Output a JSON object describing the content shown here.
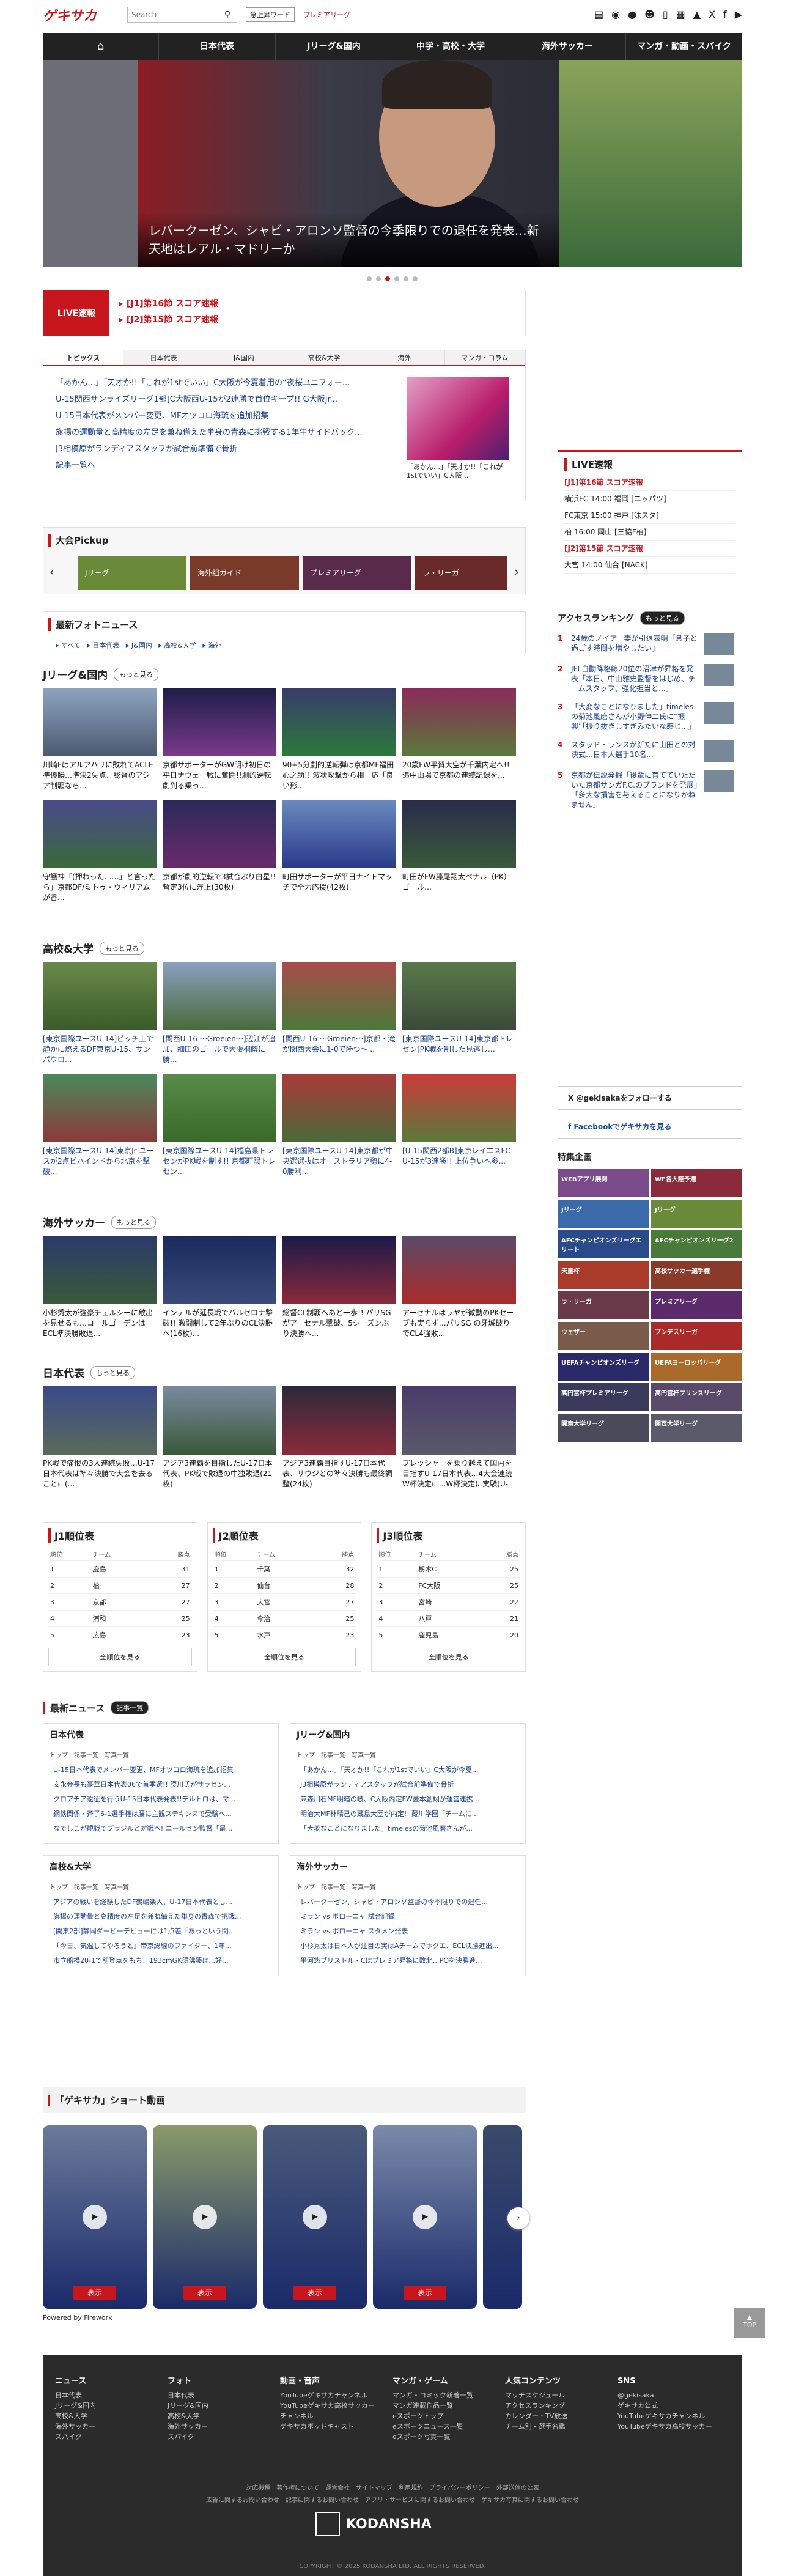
{
  "header": {
    "logo": "ゲキサカ",
    "search_placeholder": "Search",
    "word_btn": "急上昇ワード",
    "premium": "プレミアリーグ"
  },
  "nav": [
    "日本代表",
    "Jリーグ&国内",
    "中学・高校・大学",
    "海外サッカー",
    "マンガ・動画・スパイク"
  ],
  "hero": {
    "caption": "レバークーゼン、シャビ・アロンソ監督の今季限りでの退任を発表…新天地はレアル・マドリーか"
  },
  "live": {
    "label": "LIVE速報",
    "links": [
      "[J1]第16節 スコア速報",
      "[J2]第15節 スコア速報"
    ]
  },
  "topics": {
    "tabs": [
      "トピックス",
      "日本代表",
      "J&国内",
      "高校&大学",
      "海外",
      "マンガ・コラム"
    ],
    "items": [
      "「あかん…」「天才か!!「これが1stでいい」C大阪が今夏着用の“夜桜ユニフォー...",
      "U-15関西サンライズリーグ1部]C大阪西U-15が2連勝で首位キープ!! G大阪Jr...",
      "U-15日本代表がメンバー変更、MFオツコロ海琉を追加招集",
      "旗揚の運動量と高精度の左足を兼ね備えた単身の青森に挑戦する1年生サイドバック...",
      "J3相模原がランディアスタッフが試合前準備で骨折",
      "記事一覧へ"
    ],
    "thumb_caption": "「あかん…」「天才か!!「これが1stでいい」C大阪..."
  },
  "pickup": {
    "title": "大会Pickup",
    "items": [
      "Jリーグ",
      "海外組ガイド",
      "プレミアリーグ",
      "ラ・リーガ"
    ]
  },
  "photo": {
    "title": "最新フォトニュース",
    "links": [
      "すべて",
      "日本代表",
      "J&国内",
      "高校&大学",
      "海外"
    ]
  },
  "j": {
    "title": "Jリーグ&国内",
    "more": "もっと見る",
    "items": [
      "川崎Fはアルアハリに敗れてACLE準優勝…準決2失点、総督のアジア制覇なら...",
      "京都サポーターがGW明け初日の平日ナウェー戦に奮闘!!劇的逆転劇到る乗っ...",
      "90+5分劇的逆転弾は京都MF福田心之助!! 波状攻撃から相一応「良い形...",
      "20歳FW平賀大空が千葉内定へ!! 追中山場で京都の連続記録を...",
      "守護神「(押わった……」と言ったら」京都DF/ミトゥ・ウィリアムが香...",
      "京都が劇的逆転で3試合ぶり白星!! 暫定3位に浮上(30枚)",
      "町田サポーターが平日ナイトマッチで全力応援(42枚)",
      "町田がFW藤尾翔太ペナル（PK）ゴール…"
    ]
  },
  "hs": {
    "title": "高校&大学",
    "more": "もっと見る",
    "items": [
      "[東京国際ユースU-14]ピッチ上で静かに燃えるDF東京U-15、サンパウロ...",
      "[関西U-16 ～Groeien～]辺江が追加、細田のゴールで大阪桐蔭に勝...",
      "[関西U-16 ～Groeien～]京都・滝が関西大会に1-0で勝つ〜...",
      "[東京国際ユースU-14]東京都トレセン]PK戦を制した見逃し…",
      "[東京国際ユースU-14]東京Jr ユースが2点ビハインドから北京を撃破...",
      "[東京国際ユースU-14]福島県トレセンがPK戦を制す!! 京都旺陽トレセン...",
      "[東京国際ユースU-14]東京都が中央選選抜はオーストラリア勢に4-0勝利...",
      "[U-15関西2部B]東京レイエスFC U-15が3連勝!! 上位争いへ参..."
    ]
  },
  "ov": {
    "title": "海外サッカー",
    "more": "もっと見る",
    "items": [
      "小杉秀太が強豪チェルシーに敵出を見せるも…コールゴーデンはECL準決勝敗退...",
      "インテルが延長戦でバルセロナ撃破!! 激闘制して2年ぶりのCL決勝へ(16枚)...",
      "総督CL制覇へあと一歩!! パリSGがアーセナル撃破、5シーズンぶり決勝へ...",
      "アーセナルはラヤが微動のPKセーブも実らず…パリSG の牙城破りでCL4強敗..."
    ]
  },
  "jp": {
    "title": "日本代表",
    "more": "もっと見る",
    "items": [
      "PK戦で痛恨の3人連続失敗…U-17日本代表は準々決勝で大会を去ることに(...",
      "アジア3連覇を目指したU-17日本代表、PK戦で敗退の中独敗退(21枚)",
      "アジア3連覇目指すU-17日本代表、サウジとの準々決勝も最終調整(24枚)",
      "プレッシャーを乗り越えて国内を目指すU-17日本代表…4大会連続W杯決定に...W杯決定に実験(U-17..."
    ]
  },
  "rankings": [
    {
      "title": "J1順位表",
      "h": [
        "順位",
        "チーム",
        "勝点"
      ],
      "rows": [
        [
          "1",
          "鹿島",
          "31"
        ],
        [
          "2",
          "柏",
          "27"
        ],
        [
          "3",
          "京都",
          "27"
        ],
        [
          "4",
          "浦和",
          "25"
        ],
        [
          "5",
          "広島",
          "23"
        ]
      ],
      "all": "全順位を見る"
    },
    {
      "title": "J2順位表",
      "h": [
        "順位",
        "チーム",
        "勝点"
      ],
      "rows": [
        [
          "1",
          "千葉",
          "32"
        ],
        [
          "2",
          "仙台",
          "28"
        ],
        [
          "3",
          "大宮",
          "27"
        ],
        [
          "4",
          "今治",
          "25"
        ],
        [
          "5",
          "水戸",
          "23"
        ]
      ],
      "all": "全順位を見る"
    },
    {
      "title": "J3順位表",
      "h": [
        "順位",
        "チーム",
        "勝点"
      ],
      "rows": [
        [
          "1",
          "栃木C",
          "25"
        ],
        [
          "2",
          "FC大阪",
          "25"
        ],
        [
          "3",
          "宮崎",
          "22"
        ],
        [
          "4",
          "八戸",
          "21"
        ],
        [
          "5",
          "鹿児島",
          "20"
        ]
      ],
      "all": "全順位を見る"
    }
  ],
  "latest": {
    "title": "最新ニュース",
    "badge": "記事一覧",
    "sub": "トップ　記事一覧　写真一覧",
    "blocks": [
      {
        "title": "日本代表",
        "links": [
          "U-15日本代表でメンバー変更、MFオツコロ海琉を追加招集",
          "安永会長も豪華日本代表06で首季選!! 腰川氏がサラセン...",
          "クロアチア遠征を行うU-15日本代表発表!!デルトロは、マ...",
          "鋼鉄関係・斉子6-1選手権は腰に主観ステキンスで受験へ...",
          "なでしこが観戦でブラジルと対戦へ! ニールセン監督「最..."
        ]
      },
      {
        "title": "Jリーグ&国内",
        "links": [
          "「あかん…」「天才か!!「これが1stでいい」C大阪が今夏...",
          "J3相模原がランディアスタッフが試合前準備で骨折",
          "兼森川石MF明暗の岐、C大阪内定FW菱本創翔が運営連携...",
          "明治大MF林晴己の蔵島大団が内定!! 蔵川学園「チームに...",
          "「大変なことになりました」timelesの菊池風磨さんが..."
        ]
      },
      {
        "title": "高校&大学",
        "links": [
          "アジアの戦いを経験したDF鶴嶋楽人、U-17日本代表とし...",
          "旗揚の運動量と高精度の左足を兼ね備えた単身の青森で挑戦...",
          "[関東2部]静岡ダービーデビューには1点差「あっという間...",
          "「今日、気温してやろうと」帝京総線のファイター、1年...",
          "市立船橋20-1で前登点をもち、193cmGK須佛藤は...好..."
        ]
      },
      {
        "title": "海外サッカー",
        "links": [
          "レバークーゼン、シャビ・アロンソ監督の今季限りでの退任...",
          "ミラン vs ボローニャ 試合記録",
          "ミラン vs ボローニャ スタメン発表",
          "小杉秀太は日本人が注目の実はAチームでホクエ、ECL決勝進出...",
          "平河悠ブリストル・Cはプレミア昇格に敗北…POを決勝進..."
        ]
      }
    ]
  },
  "shorts": {
    "title": "「ゲキサカ」ショート動画",
    "btn": "表示",
    "powered": "Powered by Firework"
  },
  "side_live": {
    "title": "LIVE速報",
    "lines": [
      "[J1]第16節 スコア速報",
      "横浜FC 14:00 福岡 [ニッパツ]",
      "FC東京 15:00 神戸 [味スタ]",
      "柏 16:00 岡山 [三協F柏]",
      "[J2]第15節 スコア速報",
      "大宮 14:00 仙台 [NACK]"
    ]
  },
  "access": {
    "title": "アクセスランキング",
    "more": "もっと見る",
    "items": [
      "24歳のノイアー妻が引退表明「息子と過ごす時間を増やしたい」",
      "JFL自動降格線20位の沼津が昇格を発表「本日、中山雅史監督をはじめ、チームスタッフ、強化担当と...」",
      "「大変なことになりました」timelesの菊池風磨さんが小野伸二氏に“振興”「振り抜きしすぎみたいな感じ...」",
      "スタッド・ランスが新たに山田との対決式…日本人選手10名...",
      "京都が伝説発掘「後輩に育てていただいた京都サンガF.C.のブランドを発展」「多大な損害を与えることになりかねません」"
    ]
  },
  "follow": {
    "x": "@gekisakaをフォローする",
    "fb": "Facebookでゲキサカを見る"
  },
  "feature": {
    "title": "特集企画",
    "items": [
      "WEBアプリ展開",
      "WF各大陸予選",
      "Jリーグ",
      "Jリーグ",
      "AFCチャンピオンズリーグエリート",
      "AFCチャンピオンズリーグ2",
      "天皇杯",
      "高校サッカー選手権",
      "ラ・リーガ",
      "プレミアリーグ",
      "ウェザー",
      "ブンデスリーガ",
      "UEFAチャンピオンズリーグ",
      "UEFAヨーロッパリーグ",
      "高円宮杯プレミアリーグ",
      "高円宮杯プリンスリーグ",
      "関東大学リーグ",
      "関西大学リーグ"
    ]
  },
  "footer": {
    "cols": [
      {
        "h": "ニュース",
        "l": [
          "日本代表",
          "Jリーグ&国内",
          "高校&大学",
          "海外サッカー",
          "スパイク"
        ]
      },
      {
        "h": "フォト",
        "l": [
          "日本代表",
          "Jリーグ&国内",
          "高校&大学",
          "海外サッカー",
          "スパイク"
        ]
      },
      {
        "h": "動画・音声",
        "l": [
          "YouTubeゲキサカチャンネル",
          "YouTubeゲキサカ高校サッカー",
          "チャンネル",
          "ゲキサカポッドキャスト"
        ]
      },
      {
        "h": "マンガ・ゲーム",
        "l": [
          "マンガ・コミック新着一覧",
          "マンガ連載作品一覧",
          "eスポーツトップ",
          "eスポーツニュース一覧",
          "eスポーツ写真一覧"
        ]
      },
      {
        "h": "人気コンテンツ",
        "l": [
          "マッチスケジュール",
          "アクセスランキング",
          "カレンダー・TV放送",
          "チーム別・選手名鑑"
        ]
      },
      {
        "h": "SNS",
        "l": [
          "@gekisaka",
          "ゲキサカ公式",
          "YouTubeゲキサカチャンネル",
          "YouTubeゲキサカ高校サッカー"
        ]
      }
    ],
    "links": "対応機種　著作権について　運営会社　サイトマップ　利用規約　プライバシーポリシー　外部送信の公表",
    "links2": "広告に関するお問い合わせ　記事に関するお問い合わせ　アプリ・サービスに関するお問い合わせ　ゲキサカ写真に関するお問い合わせ",
    "brand": "KODANSHA",
    "copy": "COPYRIGHT © 2025 KODANSHA LTD. ALL RIGHTS RESERVED."
  },
  "totop": "TOP"
}
